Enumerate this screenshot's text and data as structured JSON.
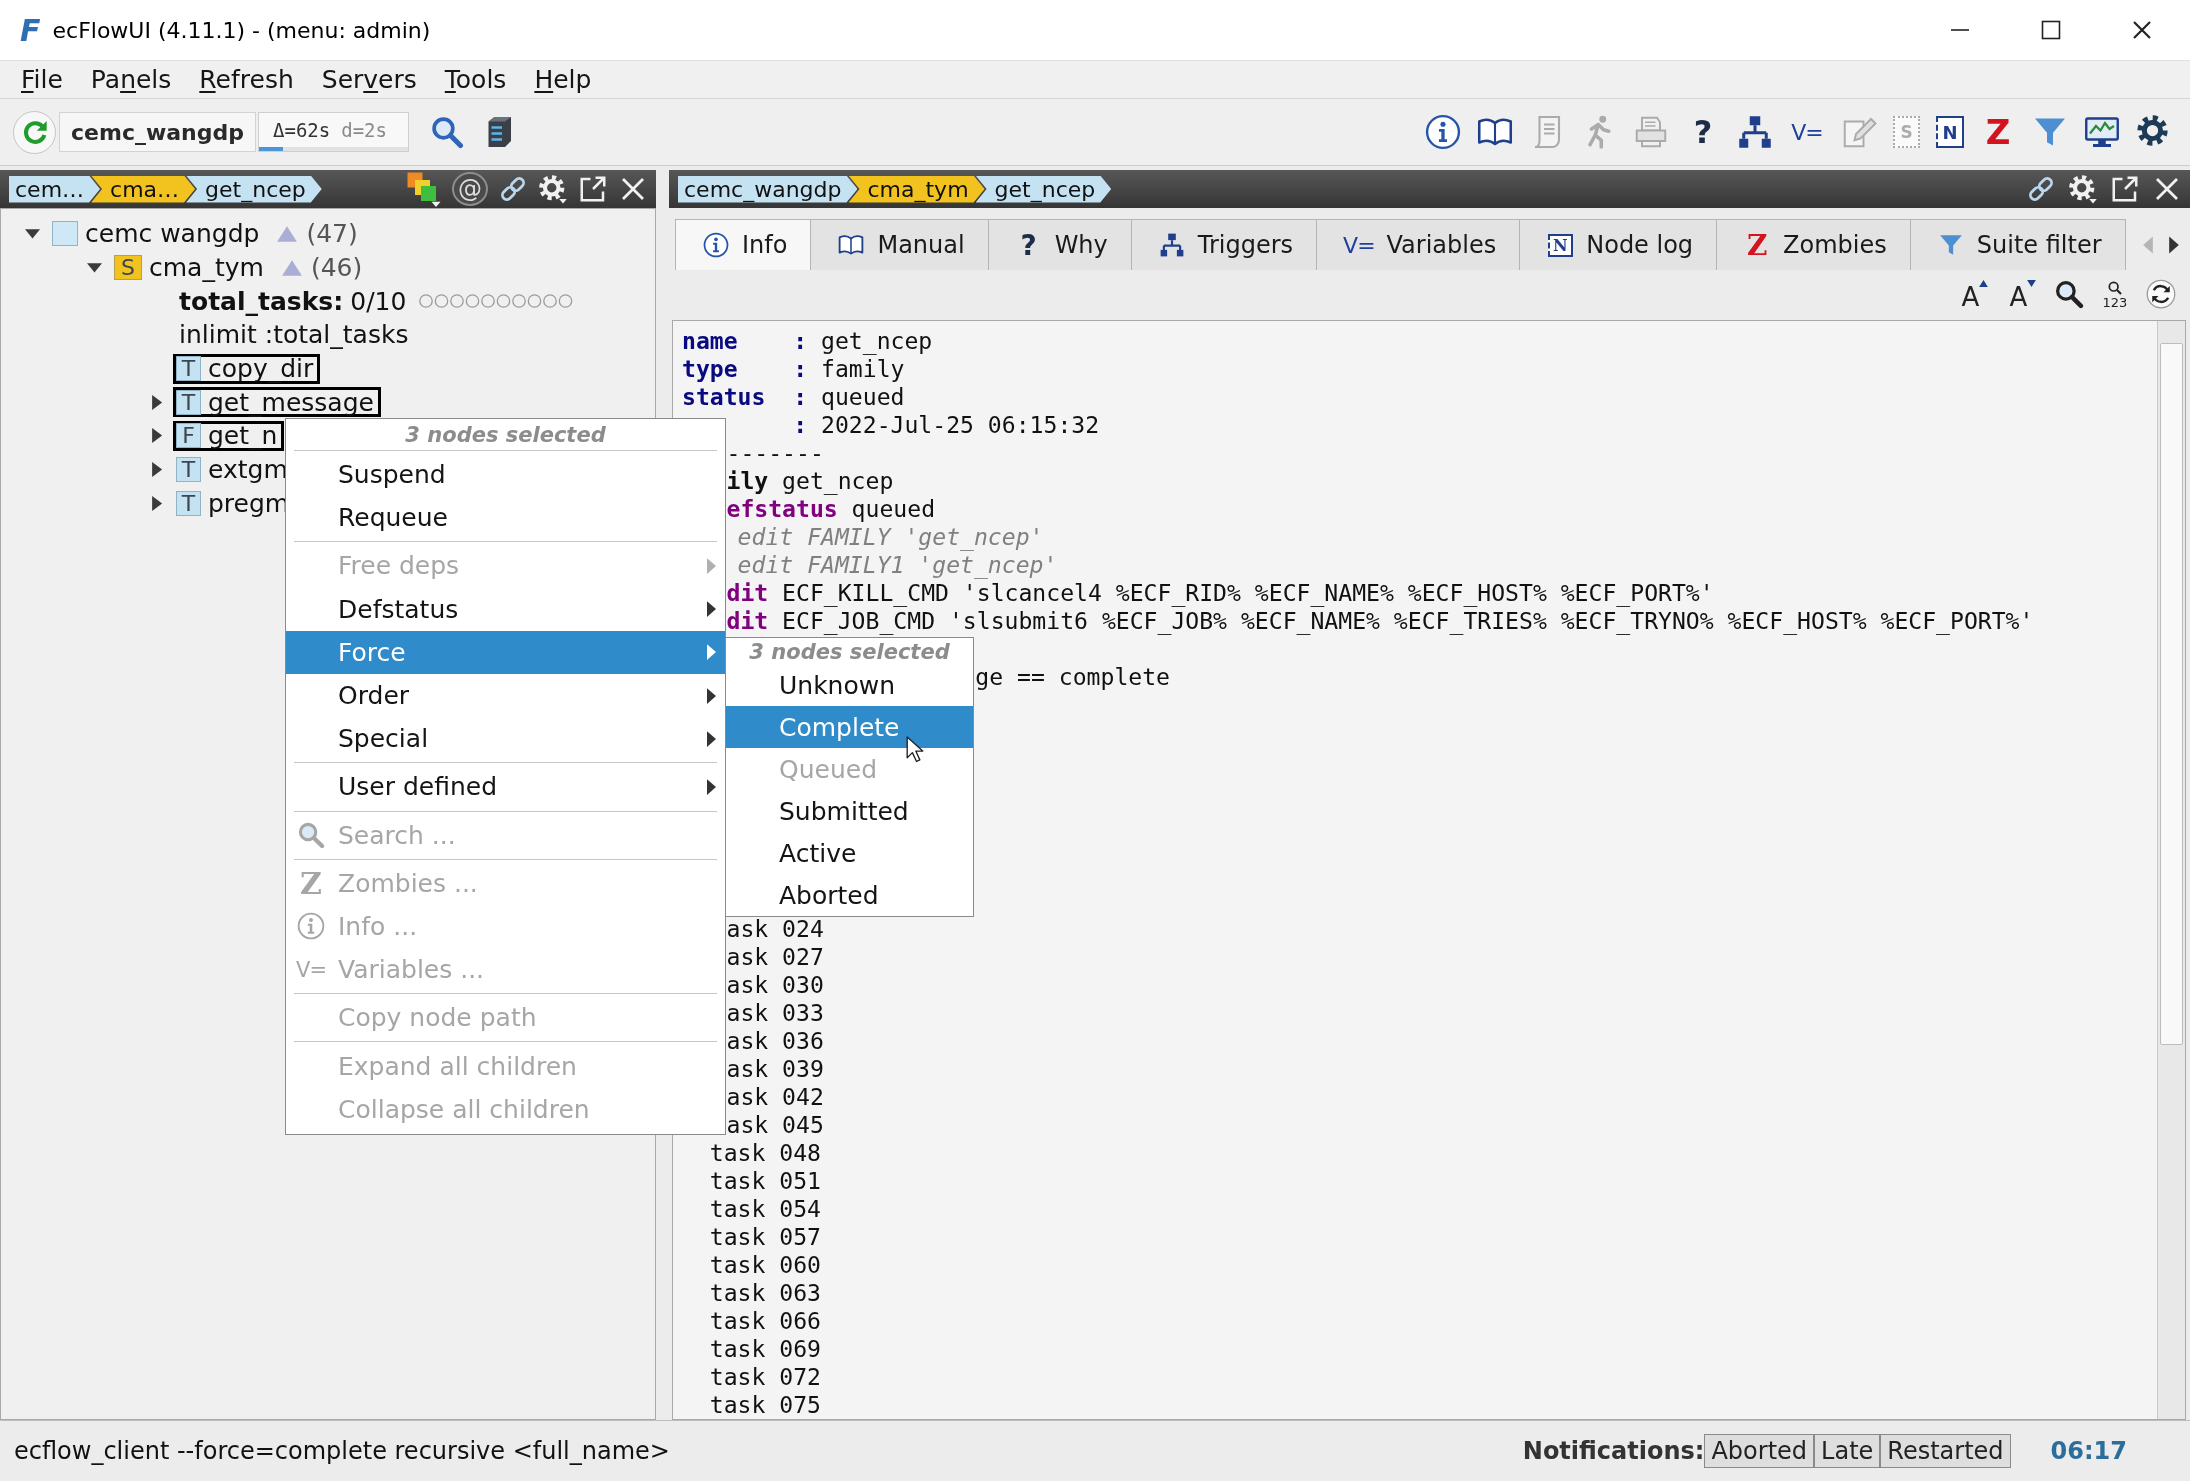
{
  "window": {
    "logo": "F",
    "title": "ecFlowUI (4.11.1) - (menu: admin)"
  },
  "menu_bar": [
    {
      "mnemonic": "F",
      "after": "ile"
    },
    {
      "before": "Pa",
      "mnemonic": "n",
      "after": "els"
    },
    {
      "mnemonic": "R",
      "after": "efresh"
    },
    {
      "before": "Ser",
      "mnemonic": "v",
      "after": "ers"
    },
    {
      "mnemonic": "T",
      "after": "ools"
    },
    {
      "mnemonic": "H",
      "after": "elp"
    }
  ],
  "toolbar": {
    "server": "cemc_wangdp",
    "refresh_info": {
      "delta": "Δ=62s",
      "drift": "d=2s",
      "level": 0.16
    },
    "icons": [
      {
        "kind": "info",
        "disabled": false
      },
      {
        "kind": "manual",
        "disabled": false
      },
      {
        "kind": "script",
        "disabled": true
      },
      {
        "kind": "run",
        "disabled": true
      },
      {
        "kind": "job",
        "disabled": true
      },
      {
        "kind": "why",
        "glyph": "?",
        "disabled": false
      },
      {
        "kind": "triggers",
        "disabled": false
      },
      {
        "kind": "variables",
        "glyph": "V=",
        "disabled": false
      },
      {
        "kind": "edit",
        "disabled": true
      },
      {
        "kind": "script_text",
        "glyph": "S",
        "disabled": true
      },
      {
        "kind": "node_log",
        "glyph": "N",
        "disabled": false
      },
      {
        "kind": "zombies",
        "glyph": "Z",
        "disabled": false
      },
      {
        "kind": "suite_filter",
        "disabled": false
      },
      {
        "kind": "monitor",
        "disabled": false
      },
      {
        "kind": "settings",
        "disabled": false
      }
    ]
  },
  "left_panel": {
    "breadcrumbs": [
      {
        "label": "cem…",
        "color": "#c4e2f1"
      },
      {
        "label": "cma…",
        "color": "#f2c21e"
      },
      {
        "label": "get_ncep",
        "color": "#c4e2f1"
      }
    ],
    "tools": [
      {
        "kind": "status_filter"
      },
      {
        "kind": "attribute_filter",
        "glyph": "@"
      },
      {
        "kind": "link"
      },
      {
        "kind": "settings_menu"
      },
      {
        "kind": "detach"
      },
      {
        "kind": "close"
      }
    ],
    "tree": [
      {
        "kind": "server",
        "name": "cemc wangdp",
        "color": "#cfe8f6",
        "count": "(47)",
        "expanded": true,
        "selected": false,
        "children": [
          {
            "kind": "suite",
            "letter": "S",
            "name": "cma_tym",
            "color": "#f2c21e",
            "count": "(46)",
            "expanded": true,
            "selected": false,
            "children": [
              {
                "kind": "limit",
                "name": "total_tasks:",
                "value": "0/10",
                "selected": false
              },
              {
                "kind": "inlimit",
                "name": "inlimit :total_tasks",
                "selected": false
              },
              {
                "kind": "task",
                "letter": "T",
                "name": "copy_dir",
                "color": "#c4e2f1",
                "selected": true
              },
              {
                "kind": "task",
                "letter": "T",
                "name": "get_message",
                "color": "#c4e2f1",
                "selected": true,
                "expanded": false
              },
              {
                "kind": "family",
                "letter": "F",
                "name": "get_n",
                "color": "#c4e2f1",
                "selected": true,
                "expanded": false
              },
              {
                "kind": "task",
                "letter": "T",
                "name": "extgm",
                "color": "#c4e2f1",
                "selected": false,
                "expanded": false
              },
              {
                "kind": "task",
                "letter": "T",
                "name": "pregm",
                "color": "#c4e2f1",
                "selected": false,
                "expanded": false
              }
            ]
          }
        ]
      }
    ]
  },
  "right_panel": {
    "breadcrumbs": [
      {
        "label": "cemc_wangdp",
        "color": "#c4e2f1"
      },
      {
        "label": "cma_tym",
        "color": "#f2c21e"
      },
      {
        "label": "get_ncep",
        "color": "#c4e2f1"
      }
    ],
    "tools": [
      {
        "kind": "link"
      },
      {
        "kind": "settings_menu"
      },
      {
        "kind": "detach"
      },
      {
        "kind": "close"
      }
    ],
    "tabs": [
      {
        "kind": "info",
        "label": "Info",
        "selected": true
      },
      {
        "kind": "manual",
        "label": "Manual",
        "selected": false
      },
      {
        "kind": "why",
        "glyph": "?",
        "label": "Why",
        "selected": false
      },
      {
        "kind": "triggers",
        "label": "Triggers",
        "selected": false
      },
      {
        "kind": "variables",
        "glyph": "V=",
        "label": "Variables",
        "selected": false
      },
      {
        "kind": "node_log",
        "glyph": "N",
        "label": "Node log",
        "selected": false
      },
      {
        "kind": "zombies",
        "glyph": "Z",
        "label": "Zombies",
        "selected": false
      },
      {
        "kind": "suite_filter",
        "label": "Suite filter",
        "selected": false
      }
    ],
    "tab_scroll": [
      {
        "kind": "left",
        "disabled": true
      },
      {
        "kind": "right",
        "disabled": false
      }
    ],
    "text_tools": [
      {
        "kind": "font_up",
        "glyph": "A"
      },
      {
        "kind": "font_down",
        "glyph": "A"
      },
      {
        "kind": "search"
      },
      {
        "kind": "line_numbers",
        "glyph": "123"
      },
      {
        "kind": "reload"
      }
    ],
    "info_text": {
      "lines_upper": [
        {
          "kind": "field",
          "segments": [
            {
              "text": "name    :",
              "kind": "label"
            },
            {
              "text": " get_ncep",
              "kind": "value"
            }
          ]
        },
        {
          "kind": "field",
          "segments": [
            {
              "text": "type    :",
              "kind": "label"
            },
            {
              "text": " family",
              "kind": "value"
            }
          ]
        },
        {
          "kind": "field",
          "segments": [
            {
              "text": "status  :",
              "kind": "label"
            },
            {
              "text": " queued",
              "kind": "value"
            }
          ]
        },
        {
          "kind": "cut_field",
          "segments": [
            {
              "text": ":",
              "kind": "label"
            },
            {
              "text": " 2022-Jul-25 06:15:32",
              "kind": "value"
            }
          ]
        },
        {
          "kind": "cut",
          "segments": [
            {
              "text": "-------",
              "kind": "value"
            }
          ]
        },
        {
          "kind": "cut",
          "segments": [
            {
              "text": "ily",
              "kind": "node_keyword"
            },
            {
              "text": " get_ncep",
              "kind": "value"
            }
          ]
        },
        {
          "kind": "cut",
          "segments": [
            {
              "text": "efstatus",
              "kind": "attribute_keyword"
            },
            {
              "text": " queued",
              "kind": "value"
            }
          ]
        },
        {
          "kind": "cut_comment",
          "segments": [
            {
              "text": "edit FAMILY 'get_ncep'",
              "kind": "comment"
            }
          ]
        },
        {
          "kind": "cut_comment",
          "segments": [
            {
              "text": "edit FAMILY1 'get_ncep'",
              "kind": "comment"
            }
          ]
        },
        {
          "kind": "cut",
          "segments": [
            {
              "text": "dit",
              "kind": "attribute_keyword"
            },
            {
              "text": " ECF_KILL_CMD 'slcancel4 %ECF_RID% %ECF_NAME% %ECF_HOST% %ECF_PORT%'",
              "kind": "value"
            }
          ]
        },
        {
          "kind": "cut",
          "segments": [
            {
              "text": "dit",
              "kind": "attribute_keyword"
            },
            {
              "text": " ECF_JOB_CMD 'slsubmit6 %ECF_JOB% %ECF_NAME% %ECF_TRIES% %ECF_TRYNO% %ECF_HOST% %ECF_PORT%'",
              "kind": "value"
            }
          ]
        },
        {
          "kind": "after_submenu",
          "segments": [
            {
              "text": "ge == complete",
              "kind": "value"
            }
          ]
        }
      ],
      "lines_lower": [
        {
          "kind": "cut",
          "segments": [
            {
              "text": "ask 024",
              "kind": "value"
            }
          ]
        },
        {
          "kind": "cut",
          "segments": [
            {
              "text": "ask 027",
              "kind": "value"
            }
          ]
        },
        {
          "kind": "cut",
          "segments": [
            {
              "text": "ask 030",
              "kind": "value"
            }
          ]
        },
        {
          "kind": "cut",
          "segments": [
            {
              "text": "ask 033",
              "kind": "value"
            }
          ]
        },
        {
          "kind": "cut",
          "segments": [
            {
              "text": "ask 036",
              "kind": "value"
            }
          ]
        },
        {
          "kind": "cut",
          "segments": [
            {
              "text": "ask 039",
              "kind": "value"
            }
          ]
        },
        {
          "kind": "cut",
          "segments": [
            {
              "text": "ask 042",
              "kind": "value"
            }
          ]
        },
        {
          "kind": "cut",
          "segments": [
            {
              "text": "ask 045",
              "kind": "value"
            }
          ]
        },
        {
          "kind": "body",
          "segments": [
            {
              "text": "task 048",
              "kind": "value"
            }
          ]
        },
        {
          "kind": "body",
          "segments": [
            {
              "text": "task 051",
              "kind": "value"
            }
          ]
        },
        {
          "kind": "body",
          "segments": [
            {
              "text": "task 054",
              "kind": "value"
            }
          ]
        },
        {
          "kind": "body",
          "segments": [
            {
              "text": "task 057",
              "kind": "value"
            }
          ]
        },
        {
          "kind": "body",
          "segments": [
            {
              "text": "task 060",
              "kind": "value"
            }
          ]
        },
        {
          "kind": "body",
          "segments": [
            {
              "text": "task 063",
              "kind": "value"
            }
          ]
        },
        {
          "kind": "body",
          "segments": [
            {
              "text": "task 066",
              "kind": "value"
            }
          ]
        },
        {
          "kind": "body",
          "segments": [
            {
              "text": "task 069",
              "kind": "value"
            }
          ]
        },
        {
          "kind": "body",
          "segments": [
            {
              "text": "task 072",
              "kind": "value"
            }
          ]
        },
        {
          "kind": "body",
          "segments": [
            {
              "text": "task 075",
              "kind": "value"
            }
          ]
        }
      ]
    }
  },
  "context_menu": {
    "header": "3 nodes selected",
    "items": [
      {
        "kind": "separator"
      },
      {
        "kind": "item",
        "label": "Suspend",
        "selected": false,
        "disabled": false,
        "has_submenu": false
      },
      {
        "kind": "item",
        "label": "Requeue",
        "selected": false,
        "disabled": false,
        "has_submenu": false
      },
      {
        "kind": "separator"
      },
      {
        "kind": "item",
        "label": "Free deps",
        "selected": false,
        "disabled": true,
        "has_submenu": true
      },
      {
        "kind": "item",
        "label": "Defstatus",
        "selected": false,
        "disabled": false,
        "has_submenu": true
      },
      {
        "kind": "item",
        "label": "Force",
        "selected": true,
        "disabled": false,
        "has_submenu": true,
        "submenu": {
          "header": "3 nodes selected",
          "items": [
            {
              "label": "Unknown",
              "selected": false,
              "disabled": false
            },
            {
              "label": "Complete",
              "selected": true,
              "disabled": false
            },
            {
              "label": "Queued",
              "selected": false,
              "disabled": true
            },
            {
              "label": "Submitted",
              "selected": false,
              "disabled": false
            },
            {
              "label": "Active",
              "selected": false,
              "disabled": false
            },
            {
              "label": "Aborted",
              "selected": false,
              "disabled": false
            }
          ]
        }
      },
      {
        "kind": "item",
        "label": "Order",
        "selected": false,
        "disabled": false,
        "has_submenu": true
      },
      {
        "kind": "item",
        "label": "Special",
        "selected": false,
        "disabled": false,
        "has_submenu": true
      },
      {
        "kind": "separator"
      },
      {
        "kind": "item",
        "label": "User defined",
        "selected": false,
        "disabled": false,
        "has_submenu": true
      },
      {
        "kind": "separator"
      },
      {
        "kind": "search",
        "label": "Search ...",
        "selected": false,
        "disabled": true,
        "has_submenu": false
      },
      {
        "kind": "separator"
      },
      {
        "kind": "zombies",
        "label": "Zombies ...",
        "glyph": "Z",
        "selected": false,
        "disabled": true,
        "has_submenu": false
      },
      {
        "kind": "info",
        "label": "Info ...",
        "selected": false,
        "disabled": true,
        "has_submenu": false
      },
      {
        "kind": "variables",
        "label": "Variables ...",
        "glyph": "V=",
        "selected": false,
        "disabled": true,
        "has_submenu": false
      },
      {
        "kind": "separator"
      },
      {
        "kind": "item",
        "label": "Copy node path",
        "selected": false,
        "disabled": true,
        "has_submenu": false
      },
      {
        "kind": "separator"
      },
      {
        "kind": "item",
        "label": "Expand all children",
        "selected": false,
        "disabled": true,
        "has_submenu": false
      },
      {
        "kind": "item",
        "label": "Collapse all children",
        "selected": false,
        "disabled": true,
        "has_submenu": false
      }
    ]
  },
  "status_bar": {
    "command": "ecflow_client --force=complete recursive <full_name>",
    "notifications_label": "Notifications:",
    "notifications": [
      "Aborted",
      "Late",
      "Restarted"
    ],
    "time": "06:17"
  }
}
